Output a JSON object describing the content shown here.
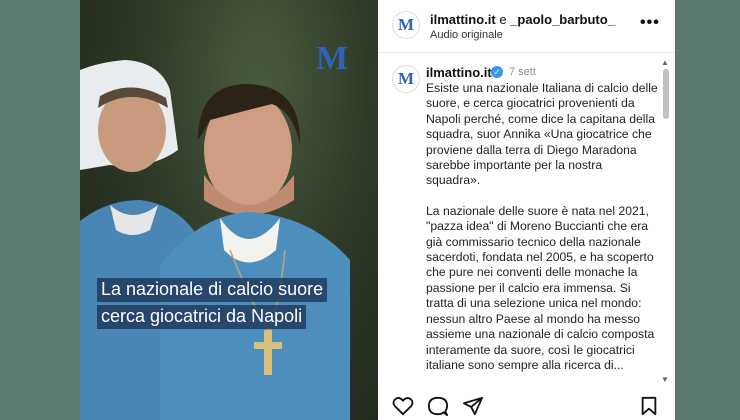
{
  "post": {
    "media": {
      "caption_line1": "La nazionale di calcio suore",
      "caption_line2": "cerca giocatrici da Napoli",
      "watermark": "M"
    },
    "header": {
      "account": "ilmattino.it",
      "connector": " e ",
      "coauthor": "_paolo_barbuto_",
      "audio": "Audio originale",
      "avatar_letter": "M",
      "more_label": "•••"
    },
    "comment": {
      "username": "ilmattino.it",
      "verified_glyph": "✓",
      "time": "7 sett",
      "avatar_letter": "M",
      "paragraph1": "Esiste una nazionale Italiana di calcio delle suore, e cerca giocatrici provenienti da Napoli perché, come dice la capitana della squadra, suor Annika «Una giocatrice che proviene dalla terra di Diego Maradona sarebbe importante per la nostra squadra».",
      "paragraph2": "La nazionale delle suore è nata nel 2021, \"pazza idea\" di Moreno Buccianti che era già commissario tecnico della nazionale sacerdoti, fondata nel 2005, e ha scoperto che pure nei conventi delle monache la passione per il calcio era immensa. Si tratta di una selezione unica nel mondo: nessun altro Paese al mondo ha messo assieme una nazionale di calcio composta interamente da suore, così le giocatrici italiane sono sempre alla ricerca di..."
    },
    "scrollbar": {
      "up": "▲",
      "down": "▼"
    },
    "actions": [
      "like-icon",
      "comment-icon",
      "share-icon",
      "save-icon"
    ]
  },
  "colors": {
    "background": "#5d7a70",
    "brand_blue": "#2f62b8",
    "caption_bg": "#1e375a",
    "verified": "#3897f0"
  }
}
